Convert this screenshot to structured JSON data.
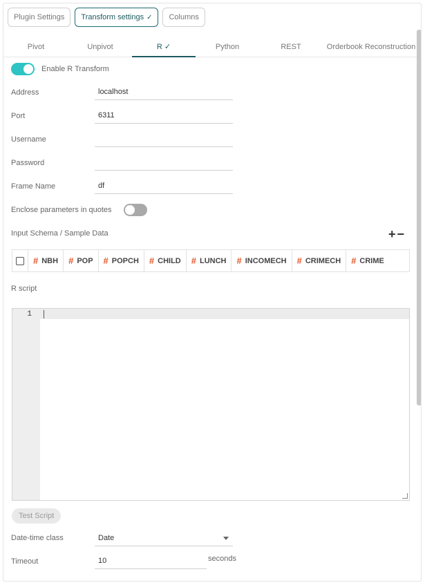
{
  "top_tabs": [
    {
      "label": "Plugin Settings",
      "active": false
    },
    {
      "label": "Transform settings",
      "active": true,
      "check": "✓"
    },
    {
      "label": "Columns",
      "active": false
    }
  ],
  "sub_tabs": [
    {
      "label": "Pivot"
    },
    {
      "label": "Unpivot"
    },
    {
      "label": "R ✓",
      "active": true
    },
    {
      "label": "Python"
    },
    {
      "label": "REST"
    },
    {
      "label": "Orderbook Reconstruction"
    }
  ],
  "enable_toggle": {
    "label": "Enable R Transform",
    "on": true
  },
  "fields": {
    "address": {
      "label": "Address",
      "value": "localhost"
    },
    "port": {
      "label": "Port",
      "value": "6311"
    },
    "username": {
      "label": "Username",
      "value": ""
    },
    "password": {
      "label": "Password",
      "value": ""
    },
    "frame_name": {
      "label": "Frame Name",
      "value": "df"
    }
  },
  "enclose_toggle": {
    "label": "Enclose parameters in quotes",
    "on": false
  },
  "schema": {
    "label": "Input Schema / Sample Data",
    "add_remove": "+−",
    "columns": [
      "NBH",
      "POP",
      "POPCH",
      "CHILD",
      "LUNCH",
      "INCOMECH",
      "CRIMECH",
      "CRIME"
    ],
    "type_glyph": "#"
  },
  "script": {
    "label": "R script",
    "line_number": "1",
    "content": ""
  },
  "test_button": "Test Script",
  "datetime": {
    "label": "Date-time class",
    "value": "Date"
  },
  "timeout": {
    "label": "Timeout",
    "value": "10",
    "unit": "seconds"
  },
  "colors": {
    "accent": "#2ec4c4",
    "active_tab": "#1d5a60",
    "type_hash": "#e45a2c"
  }
}
